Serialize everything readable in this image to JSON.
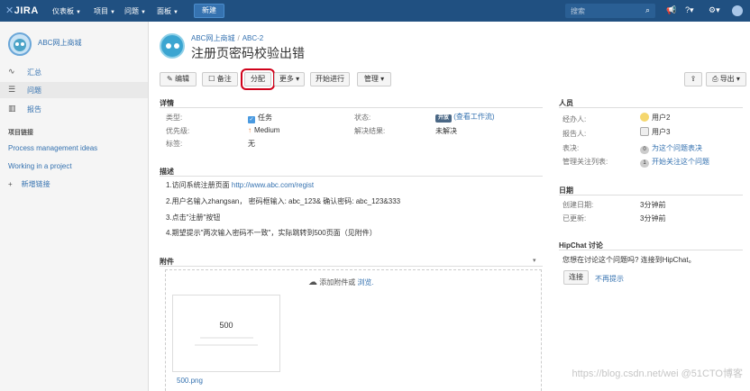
{
  "topnav": {
    "logo": "JIRA",
    "menus": [
      "仪表板",
      "项目",
      "问题",
      "面板"
    ],
    "create": "新建",
    "search_placeholder": "搜索"
  },
  "sidebar": {
    "project_name": "ABC网上商城",
    "items": [
      {
        "icon": "activity-icon",
        "label": "汇总"
      },
      {
        "icon": "issues-icon",
        "label": "问题"
      },
      {
        "icon": "reports-icon",
        "label": "报告"
      }
    ],
    "section_title": "项目链接",
    "links": [
      "Process management ideas",
      "Working in a project"
    ],
    "add_link": "新增链接"
  },
  "issue": {
    "breadcrumb_project": "ABC网上商城",
    "breadcrumb_key": "ABC-2",
    "title": "注册页密码校验出错"
  },
  "toolbar": {
    "edit": "编辑",
    "comment": "备注",
    "assign": "分配",
    "more": "更多",
    "start": "开始进行",
    "manage": "管理",
    "export": "导出"
  },
  "details": {
    "heading": "详情",
    "type_label": "类型:",
    "type_value": "任务",
    "priority_label": "优先级:",
    "priority_value": "Medium",
    "labels_label": "标签:",
    "labels_value": "无",
    "status_label": "状态:",
    "status_value": "开放",
    "status_link": "(查看工作流)",
    "resolution_label": "解决结果:",
    "resolution_value": "未解决"
  },
  "description": {
    "heading": "描述",
    "line1_prefix": "1.访问系统注册页面 ",
    "line1_url": "http://www.abc.com/regist",
    "line2": "2.用户名输入zhangsan， 密码框输入: abc_123& 确认密码: abc_123&333",
    "line3": "3.点击\"注册\"按钮",
    "line4": "4.期望提示\"两次输入密码不一致\"，实际跳转到500页面（见附件）"
  },
  "attachments": {
    "heading": "附件",
    "drop_text": "添加附件或",
    "browse": "浏览.",
    "thumb_title": "500",
    "file_name": "500.png"
  },
  "people": {
    "heading": "人员",
    "assignee_label": "经办人:",
    "assignee_value": "用户2",
    "reporter_label": "报告人:",
    "reporter_value": "用户3",
    "votes_label": "表决:",
    "votes_count": "0",
    "votes_link": "为这个问题表决",
    "watchers_label": "管理关注列表:",
    "watchers_count": "1",
    "watchers_link": "开始关注这个问题"
  },
  "dates": {
    "heading": "日期",
    "created_label": "创建日期:",
    "created_value": "3分钟前",
    "updated_label": "已更新:",
    "updated_value": "3分钟前"
  },
  "hipchat": {
    "heading": "HipChat 讨论",
    "prompt": "您想在讨论这个问题吗? 连接到HipChat。",
    "connect": "连接",
    "dismiss": "不再提示"
  },
  "watermark": "https://blog.csdn.net/wei @51CTO博客",
  "colors": {
    "topbar": "#205081",
    "link": "#3572b0",
    "highlight": "#d0021b"
  }
}
